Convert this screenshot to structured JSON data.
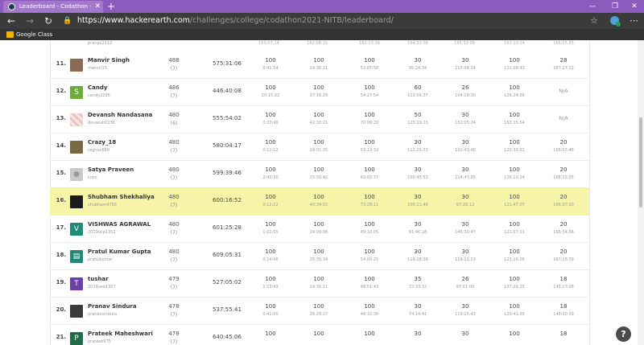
{
  "browser": {
    "tab_title": "Leaderboard - Codathon - Inter C",
    "tab_close": "✕",
    "new_tab": "+",
    "window_controls": [
      "—",
      "❐",
      "✕"
    ],
    "url_host": "https://www.hackerearth.com",
    "url_path": "/challenges/college/codathon2021-NITB/leaderboard/",
    "bookmark": "Google Class",
    "icons": [
      "back-icon",
      "forward-icon",
      "refresh-icon",
      "lock-icon",
      "star-icon",
      "extension-icon",
      "more-icon"
    ]
  },
  "leaderboard": {
    "partial_top_row": {
      "handle": "pranav2112",
      "times": [
        "163:07:14",
        "162:08:19",
        "162:13:39",
        "164:33:06",
        "165:32:09",
        "163:10:14",
        "166:55:55"
      ]
    },
    "rows": [
      {
        "rank": "11.",
        "name": "Manvir Singh",
        "handle": "manvir15",
        "score": "488",
        "sub": "(7)",
        "time": "575:31:06",
        "cells": [
          [
            "100",
            "0:41:54"
          ],
          [
            "100",
            "24:36:21"
          ],
          [
            "100",
            "53:07:58"
          ],
          [
            "30",
            "95:24:34"
          ],
          [
            "30",
            "113:04:24"
          ],
          [
            "100",
            "121:08:43"
          ],
          [
            "28",
            "167:27:12"
          ]
        ],
        "avatar": "photo",
        "avatar_color": "#8a6a55"
      },
      {
        "rank": "12.",
        "name": "Candy",
        "handle": "candy2235",
        "score": "486",
        "sub": "(7)",
        "time": "446:40:08",
        "cells": [
          [
            "100",
            "20:15:02"
          ],
          [
            "100",
            "27:16:29"
          ],
          [
            "100",
            "54:27:54"
          ],
          [
            "60",
            "113:56:37"
          ],
          [
            "26",
            "104:19:30"
          ],
          [
            "100",
            "126:24:36"
          ],
          [
            "N/A",
            ""
          ]
        ],
        "avatar": "S",
        "avatar_color": "#6aab3a"
      },
      {
        "rank": "13.",
        "name": "Devansh Nandasana",
        "handle": "devansh0136",
        "score": "480",
        "sub": "(6)",
        "time": "555:54:02",
        "cells": [
          [
            "100",
            "3:33:40"
          ],
          [
            "100",
            "42:33:21"
          ],
          [
            "100",
            "70:06:20"
          ],
          [
            "50",
            "125:19:23"
          ],
          [
            "30",
            "152:05:24"
          ],
          [
            "100",
            "162:15:54"
          ],
          [
            "N/A",
            ""
          ]
        ],
        "avatar": "pattern",
        "avatar_color": "#e9c6c1"
      },
      {
        "rank": "14.",
        "name": "Crazy_18",
        "handle": "raghav689",
        "score": "480",
        "sub": "(7)",
        "time": "580:04:17",
        "cells": [
          [
            "100",
            "0:12:12"
          ],
          [
            "100",
            "24:01:35"
          ],
          [
            "100",
            "53:13:32"
          ],
          [
            "30",
            "112:25:33"
          ],
          [
            "30",
            "102:43:48"
          ],
          [
            "100",
            "120:33:51"
          ],
          [
            "20",
            "166:53:46"
          ]
        ],
        "avatar": "photo",
        "avatar_color": "#7a6a3f"
      },
      {
        "rank": "15.",
        "name": "Satya Praveen",
        "handle": "knks",
        "score": "480",
        "sub": "(7)",
        "time": "599:39:46",
        "cells": [
          [
            "100",
            "2:40:30"
          ],
          [
            "100",
            "25:50:42"
          ],
          [
            "100",
            "63:02:37"
          ],
          [
            "30",
            "100:45:53"
          ],
          [
            "30",
            "114:47:35"
          ],
          [
            "100",
            "126:10:24"
          ],
          [
            "20",
            "166:22:05"
          ]
        ],
        "avatar": "person",
        "avatar_color": "#c9c9c9"
      },
      {
        "rank": "16.",
        "name": "Shubham Shekhaliya",
        "handle": "shubham4756",
        "score": "480",
        "sub": "(7)",
        "time": "600:16:52",
        "cells": [
          [
            "100",
            "0:12:22"
          ],
          [
            "100",
            "40:34:02"
          ],
          [
            "100",
            "73:28:11"
          ],
          [
            "30",
            "100:11:48"
          ],
          [
            "30",
            "97:26:12"
          ],
          [
            "100",
            "121:47:07"
          ],
          [
            "20",
            "166:37:10"
          ]
        ],
        "avatar": "dark",
        "avatar_color": "#1a1a1a",
        "highlight": true
      },
      {
        "rank": "17.",
        "name": "VISHWAS AGRAWAL",
        "handle": "2019ucp1352",
        "score": "480",
        "sub": "(7)",
        "time": "601:25:28",
        "cells": [
          [
            "100",
            "1:02:55"
          ],
          [
            "100",
            "24:09:06"
          ],
          [
            "100",
            "49:10:05"
          ],
          [
            "30",
            "91:40:28"
          ],
          [
            "30",
            "146:30:47"
          ],
          [
            "100",
            "121:57:11"
          ],
          [
            "20",
            "166:54:56"
          ]
        ],
        "avatar": "V",
        "avatar_color": "#1f8a78"
      },
      {
        "rank": "18.",
        "name": "Pratul Kumar Gupta",
        "handle": "pratulkumar",
        "score": "480",
        "sub": "(7)",
        "time": "609:05:31",
        "cells": [
          [
            "100",
            "0:14:46"
          ],
          [
            "100",
            "25:35:34"
          ],
          [
            "100",
            "54:00:25"
          ],
          [
            "30",
            "119:28:38"
          ],
          [
            "30",
            "119:11:23"
          ],
          [
            "100",
            "123:16:06"
          ],
          [
            "20",
            "167:18:39"
          ]
        ],
        "avatar": "chat",
        "avatar_color": "#1f8a78"
      },
      {
        "rank": "19.",
        "name": "tushar",
        "handle": "2019uee1307",
        "score": "479",
        "sub": "(7)",
        "time": "527:05:02",
        "cells": [
          [
            "100",
            "1:13:43"
          ],
          [
            "100",
            "24:31:11"
          ],
          [
            "100",
            "48:51:43"
          ],
          [
            "35",
            "72:33:32"
          ],
          [
            "26",
            "97:01:00"
          ],
          [
            "100",
            "137:26:25"
          ],
          [
            "18",
            "145:27:28"
          ]
        ],
        "avatar": "T",
        "avatar_color": "#6a3fa6"
      },
      {
        "rank": "20.",
        "name": "Pranav Sindura",
        "handle": "pranavsindura",
        "score": "478",
        "sub": "(7)",
        "time": "537:55:41",
        "cells": [
          [
            "100",
            "0:41:00"
          ],
          [
            "100",
            "26:29:27"
          ],
          [
            "100",
            "48:32:36"
          ],
          [
            "30",
            "74:14:41"
          ],
          [
            "30",
            "119:15:43"
          ],
          [
            "100",
            "120:41:35"
          ],
          [
            "18",
            "148:00:39"
          ]
        ],
        "avatar": "photo",
        "avatar_color": "#3a3a3a"
      },
      {
        "rank": "21.",
        "name": "Prateek Maheshwari",
        "handle": "prateek975",
        "score": "478",
        "sub": "(7)",
        "time": "640:45:06",
        "cells": [
          [
            "100",
            ""
          ],
          [
            "100",
            ""
          ],
          [
            "100",
            ""
          ],
          [
            "30",
            ""
          ],
          [
            "30",
            ""
          ],
          [
            "100",
            ""
          ],
          [
            "18",
            ""
          ]
        ],
        "avatar": "P",
        "avatar_color": "#1f6b4a"
      }
    ]
  },
  "help_label": "?"
}
